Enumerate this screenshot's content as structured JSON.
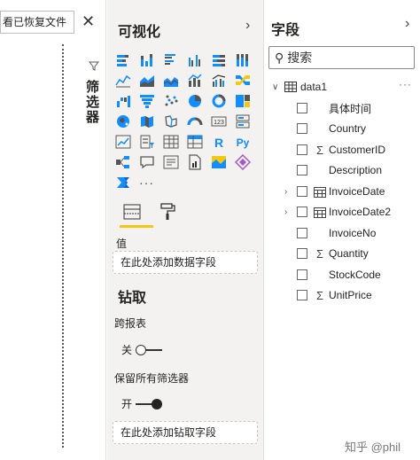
{
  "left_pane": {
    "recover_button_label": "看已恢复文件",
    "close_glyph": "✕"
  },
  "filters": {
    "title": "筛选器",
    "icon": "funnel-icon"
  },
  "visualizations": {
    "title": "可视化",
    "collapse_glyph": "›",
    "more_glyph": "···",
    "value_label": "值",
    "value_dropzone": "在此处添加数据字段",
    "drillthrough_title": "钻取",
    "cross_report_label": "跨报表",
    "cross_report_toggle": "关",
    "keep_filters_label": "保留所有筛选器",
    "keep_filters_toggle": "开",
    "drill_dropzone": "在此处添加钻取字段",
    "accent": "#f2c811"
  },
  "fields": {
    "title": "字段",
    "collapse_glyph": "›",
    "search_placeholder": "搜索",
    "table_name": "data1",
    "table_more": "···",
    "items": [
      {
        "label": "具体时间",
        "expandable": false,
        "icon": "none"
      },
      {
        "label": "Country",
        "expandable": false,
        "icon": "none"
      },
      {
        "label": "CustomerID",
        "expandable": false,
        "icon": "sigma-icon"
      },
      {
        "label": "Description",
        "expandable": false,
        "icon": "none"
      },
      {
        "label": "InvoiceDate",
        "expandable": true,
        "icon": "calendar-icon"
      },
      {
        "label": "InvoiceDate2",
        "expandable": true,
        "icon": "calendar-icon"
      },
      {
        "label": "InvoiceNo",
        "expandable": false,
        "icon": "none"
      },
      {
        "label": "Quantity",
        "expandable": false,
        "icon": "sigma-icon"
      },
      {
        "label": "StockCode",
        "expandable": false,
        "icon": "none"
      },
      {
        "label": "UnitPrice",
        "expandable": false,
        "icon": "sigma-icon"
      }
    ]
  },
  "watermark": "知乎 @phil"
}
